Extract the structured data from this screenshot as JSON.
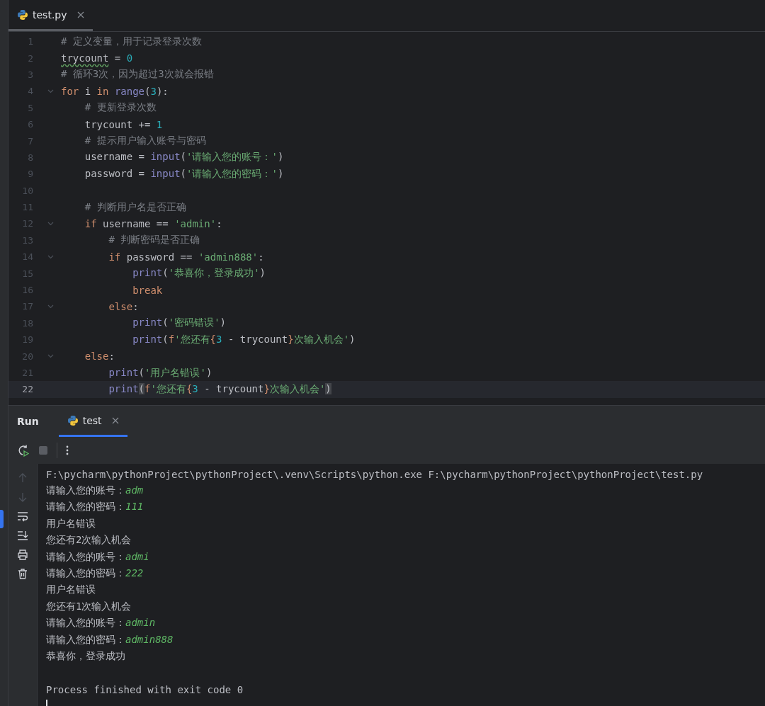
{
  "editor_tabs": [
    {
      "label": "test.py",
      "selected": true
    }
  ],
  "editor": {
    "lines": [
      {
        "number": "1",
        "fold": false,
        "current": false,
        "tokens": [
          {
            "kind": "comment",
            "text": "# 定义变量，用于记录登录次数"
          }
        ]
      },
      {
        "number": "2",
        "fold": false,
        "current": false,
        "tokens": [
          {
            "kind": "warning",
            "text": "trycount"
          },
          {
            "kind": "plain",
            "text": " = "
          },
          {
            "kind": "number",
            "text": "0"
          }
        ]
      },
      {
        "number": "3",
        "fold": false,
        "current": false,
        "tokens": [
          {
            "kind": "comment",
            "text": "# 循环3次，因为超过3次就会报错"
          }
        ]
      },
      {
        "number": "4",
        "fold": true,
        "current": false,
        "tokens": [
          {
            "kind": "keyword",
            "text": "for"
          },
          {
            "kind": "plain",
            "text": " i "
          },
          {
            "kind": "keyword",
            "text": "in"
          },
          {
            "kind": "builtin",
            "text": " range"
          },
          {
            "kind": "plain",
            "text": "("
          },
          {
            "kind": "number",
            "text": "3"
          },
          {
            "kind": "plain",
            "text": "):"
          }
        ]
      },
      {
        "number": "5",
        "fold": false,
        "current": false,
        "tokens": [
          {
            "kind": "comment",
            "text": "    # 更新登录次数"
          }
        ]
      },
      {
        "number": "6",
        "fold": false,
        "current": false,
        "tokens": [
          {
            "kind": "plain",
            "text": "    trycount += "
          },
          {
            "kind": "number",
            "text": "1"
          }
        ]
      },
      {
        "number": "7",
        "fold": false,
        "current": false,
        "tokens": [
          {
            "kind": "comment",
            "text": "    # 提示用户输入账号与密码"
          }
        ]
      },
      {
        "number": "8",
        "fold": false,
        "current": false,
        "tokens": [
          {
            "kind": "plain",
            "text": "    username = "
          },
          {
            "kind": "builtin",
            "text": "input"
          },
          {
            "kind": "plain",
            "text": "("
          },
          {
            "kind": "string",
            "text": "'请输入您的账号：'"
          },
          {
            "kind": "plain",
            "text": ")"
          }
        ]
      },
      {
        "number": "9",
        "fold": false,
        "current": false,
        "tokens": [
          {
            "kind": "plain",
            "text": "    password = "
          },
          {
            "kind": "builtin",
            "text": "input"
          },
          {
            "kind": "plain",
            "text": "("
          },
          {
            "kind": "string",
            "text": "'请输入您的密码：'"
          },
          {
            "kind": "plain",
            "text": ")"
          }
        ]
      },
      {
        "number": "10",
        "fold": false,
        "current": false
      },
      {
        "number": "11",
        "fold": false,
        "current": false,
        "tokens": [
          {
            "kind": "comment",
            "text": "    # 判断用户名是否正确"
          }
        ]
      },
      {
        "number": "12",
        "fold": true,
        "current": false,
        "tokens": [
          {
            "kind": "keyword",
            "text": "    if"
          },
          {
            "kind": "plain",
            "text": " username == "
          },
          {
            "kind": "string",
            "text": "'admin'"
          },
          {
            "kind": "plain",
            "text": ":"
          }
        ]
      },
      {
        "number": "13",
        "fold": false,
        "current": false,
        "tokens": [
          {
            "kind": "comment",
            "text": "        # 判断密码是否正确"
          }
        ]
      },
      {
        "number": "14",
        "fold": true,
        "current": false,
        "tokens": [
          {
            "kind": "keyword",
            "text": "        if"
          },
          {
            "kind": "plain",
            "text": " password == "
          },
          {
            "kind": "string",
            "text": "'admin888'"
          },
          {
            "kind": "plain",
            "text": ":"
          }
        ]
      },
      {
        "number": "15",
        "fold": false,
        "current": false,
        "tokens": [
          {
            "kind": "builtin",
            "text": "            print"
          },
          {
            "kind": "plain",
            "text": "("
          },
          {
            "kind": "string",
            "text": "'恭喜你，登录成功'"
          },
          {
            "kind": "plain",
            "text": ")"
          }
        ]
      },
      {
        "number": "16",
        "fold": false,
        "current": false,
        "tokens": [
          {
            "kind": "keyword",
            "text": "            break"
          }
        ]
      },
      {
        "number": "17",
        "fold": true,
        "current": false,
        "tokens": [
          {
            "kind": "keyword",
            "text": "        else"
          },
          {
            "kind": "plain",
            "text": ":"
          }
        ]
      },
      {
        "number": "18",
        "fold": false,
        "current": false,
        "tokens": [
          {
            "kind": "builtin",
            "text": "            print"
          },
          {
            "kind": "plain",
            "text": "("
          },
          {
            "kind": "string",
            "text": "'密码错误'"
          },
          {
            "kind": "plain",
            "text": ")"
          }
        ]
      },
      {
        "number": "19",
        "fold": false,
        "current": false,
        "tokens": [
          {
            "kind": "builtin",
            "text": "            print"
          },
          {
            "kind": "plain",
            "text": "("
          },
          {
            "kind": "keyword",
            "text": "f"
          },
          {
            "kind": "string",
            "text": "'您还有"
          },
          {
            "kind": "keyword",
            "text": "{"
          },
          {
            "kind": "number",
            "text": "3"
          },
          {
            "kind": "plain",
            "text": " - trycount"
          },
          {
            "kind": "keyword",
            "text": "}"
          },
          {
            "kind": "string",
            "text": "次输入机会'"
          },
          {
            "kind": "plain",
            "text": ")"
          }
        ]
      },
      {
        "number": "20",
        "fold": true,
        "current": false,
        "tokens": [
          {
            "kind": "keyword",
            "text": "    else"
          },
          {
            "kind": "plain",
            "text": ":"
          }
        ]
      },
      {
        "number": "21",
        "fold": false,
        "current": false,
        "tokens": [
          {
            "kind": "builtin",
            "text": "        print"
          },
          {
            "kind": "plain",
            "text": "("
          },
          {
            "kind": "string",
            "text": "'用户名错误'"
          },
          {
            "kind": "plain",
            "text": ")"
          }
        ]
      },
      {
        "number": "22",
        "fold": false,
        "current": true,
        "tokens": [
          {
            "kind": "builtin",
            "text": "        print"
          },
          {
            "kind": "bracket",
            "text": "("
          },
          {
            "kind": "keyword",
            "text": "f"
          },
          {
            "kind": "string",
            "text": "'您还有"
          },
          {
            "kind": "keyword",
            "text": "{"
          },
          {
            "kind": "number",
            "text": "3"
          },
          {
            "kind": "plain",
            "text": " - trycount"
          },
          {
            "kind": "keyword",
            "text": "}"
          },
          {
            "kind": "string",
            "text": "次输入机会'"
          },
          {
            "kind": "bracket",
            "text": ")"
          }
        ]
      }
    ]
  },
  "run_panel": {
    "title": "Run",
    "tabs": [
      {
        "label": "test",
        "selected": true
      }
    ],
    "console": [
      {
        "kind": "output",
        "text": "F:\\pycharm\\pythonProject\\pythonProject\\.venv\\Scripts\\python.exe F:\\pycharm\\pythonProject\\pythonProject\\test.py"
      },
      {
        "kind": "prompt",
        "text": "请输入您的账号：",
        "input": "adm"
      },
      {
        "kind": "prompt",
        "text": "请输入您的密码：",
        "input": "111"
      },
      {
        "kind": "output",
        "text": "用户名错误"
      },
      {
        "kind": "output",
        "text": "您还有2次输入机会"
      },
      {
        "kind": "prompt",
        "text": "请输入您的账号：",
        "input": "admi"
      },
      {
        "kind": "prompt",
        "text": "请输入您的密码：",
        "input": "222"
      },
      {
        "kind": "output",
        "text": "用户名错误"
      },
      {
        "kind": "output",
        "text": "您还有1次输入机会"
      },
      {
        "kind": "prompt",
        "text": "请输入您的账号：",
        "input": "admin"
      },
      {
        "kind": "prompt",
        "text": "请输入您的密码：",
        "input": "admin888"
      },
      {
        "kind": "output",
        "text": "恭喜你，登录成功"
      },
      {
        "kind": "blank"
      },
      {
        "kind": "output",
        "text": "Process finished with exit code 0"
      },
      {
        "kind": "cursor"
      }
    ]
  }
}
